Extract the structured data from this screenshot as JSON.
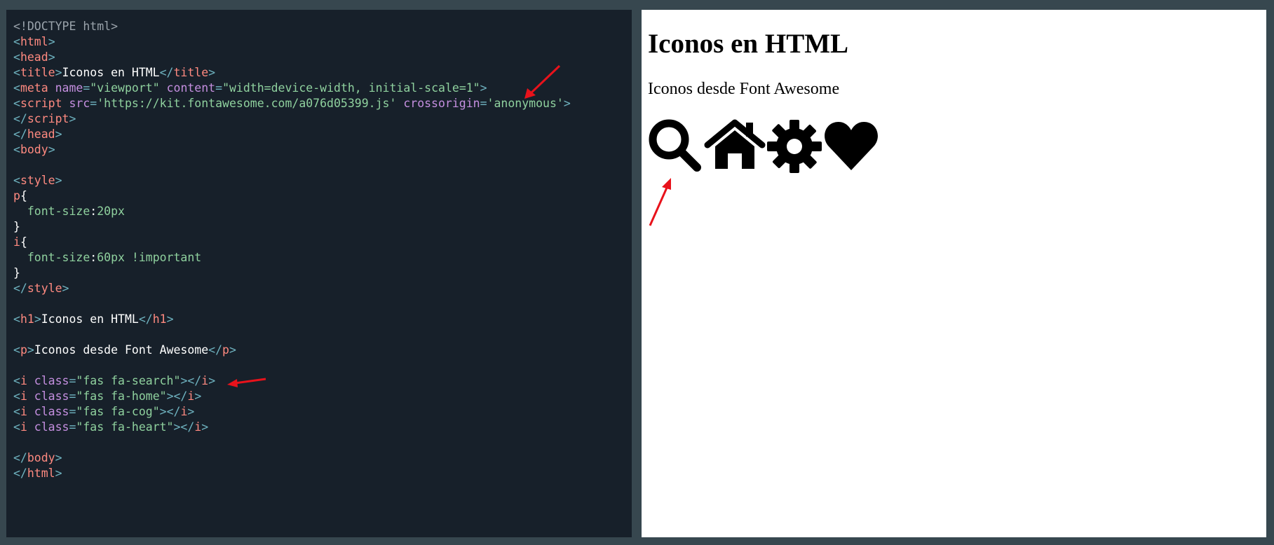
{
  "editor": {
    "lines": [
      [
        {
          "t": "<!DOCTYPE html>",
          "c": "doc"
        }
      ],
      [
        {
          "t": "<",
          "c": "punc"
        },
        {
          "t": "html",
          "c": "tag"
        },
        {
          "t": ">",
          "c": "punc"
        }
      ],
      [
        {
          "t": "<",
          "c": "punc"
        },
        {
          "t": "head",
          "c": "tag"
        },
        {
          "t": ">",
          "c": "punc"
        }
      ],
      [
        {
          "t": "<",
          "c": "punc"
        },
        {
          "t": "title",
          "c": "tag"
        },
        {
          "t": ">",
          "c": "punc"
        },
        {
          "t": "Iconos en HTML",
          "c": "text"
        },
        {
          "t": "</",
          "c": "punc"
        },
        {
          "t": "title",
          "c": "tag"
        },
        {
          "t": ">",
          "c": "punc"
        }
      ],
      [
        {
          "t": "<",
          "c": "punc"
        },
        {
          "t": "meta",
          "c": "tag"
        },
        {
          "t": " name",
          "c": "attr"
        },
        {
          "t": "=",
          "c": "punc"
        },
        {
          "t": "\"viewport\"",
          "c": "str"
        },
        {
          "t": " content",
          "c": "attr"
        },
        {
          "t": "=",
          "c": "punc"
        },
        {
          "t": "\"width=device-width, initial-scale=1\"",
          "c": "str"
        },
        {
          "t": ">",
          "c": "punc"
        }
      ],
      [
        {
          "t": "<",
          "c": "punc"
        },
        {
          "t": "script",
          "c": "tag"
        },
        {
          "t": " src",
          "c": "attr"
        },
        {
          "t": "=",
          "c": "punc"
        },
        {
          "t": "'https://kit.fontawesome.com/a076d05399.js'",
          "c": "str"
        },
        {
          "t": " crossorigin",
          "c": "attr"
        },
        {
          "t": "=",
          "c": "punc"
        },
        {
          "t": "'anonymous'",
          "c": "str"
        },
        {
          "t": ">",
          "c": "punc"
        }
      ],
      [
        {
          "t": "</",
          "c": "punc"
        },
        {
          "t": "script",
          "c": "tag"
        },
        {
          "t": ">",
          "c": "punc"
        }
      ],
      [
        {
          "t": "</",
          "c": "punc"
        },
        {
          "t": "head",
          "c": "tag"
        },
        {
          "t": ">",
          "c": "punc"
        }
      ],
      [
        {
          "t": "<",
          "c": "punc"
        },
        {
          "t": "body",
          "c": "tag"
        },
        {
          "t": ">",
          "c": "punc"
        }
      ],
      [],
      [
        {
          "t": "<",
          "c": "punc"
        },
        {
          "t": "style",
          "c": "tag"
        },
        {
          "t": ">",
          "c": "punc"
        }
      ],
      [
        {
          "t": "p",
          "c": "sel"
        },
        {
          "t": "{",
          "c": "text"
        }
      ],
      [
        {
          "t": "  font-size",
          "c": "prop"
        },
        {
          "t": ":",
          "c": "text"
        },
        {
          "t": "20px",
          "c": "num"
        }
      ],
      [
        {
          "t": "}",
          "c": "text"
        }
      ],
      [
        {
          "t": "i",
          "c": "sel"
        },
        {
          "t": "{",
          "c": "text"
        }
      ],
      [
        {
          "t": "  font-size",
          "c": "prop"
        },
        {
          "t": ":",
          "c": "text"
        },
        {
          "t": "60px !important",
          "c": "num"
        }
      ],
      [
        {
          "t": "}",
          "c": "text"
        }
      ],
      [
        {
          "t": "</",
          "c": "punc"
        },
        {
          "t": "style",
          "c": "tag"
        },
        {
          "t": ">",
          "c": "punc"
        }
      ],
      [],
      [
        {
          "t": "<",
          "c": "punc"
        },
        {
          "t": "h1",
          "c": "tag"
        },
        {
          "t": ">",
          "c": "punc"
        },
        {
          "t": "Iconos en HTML",
          "c": "text"
        },
        {
          "t": "</",
          "c": "punc"
        },
        {
          "t": "h1",
          "c": "tag"
        },
        {
          "t": ">",
          "c": "punc"
        }
      ],
      [],
      [
        {
          "t": "<",
          "c": "punc"
        },
        {
          "t": "p",
          "c": "tag"
        },
        {
          "t": ">",
          "c": "punc"
        },
        {
          "t": "Iconos desde Font Awesome",
          "c": "text"
        },
        {
          "t": "</",
          "c": "punc"
        },
        {
          "t": "p",
          "c": "tag"
        },
        {
          "t": ">",
          "c": "punc"
        }
      ],
      [],
      [
        {
          "t": "<",
          "c": "punc"
        },
        {
          "t": "i",
          "c": "tag"
        },
        {
          "t": " class",
          "c": "attr"
        },
        {
          "t": "=",
          "c": "punc"
        },
        {
          "t": "\"fas fa-search\"",
          "c": "str"
        },
        {
          "t": "></",
          "c": "punc"
        },
        {
          "t": "i",
          "c": "tag"
        },
        {
          "t": ">",
          "c": "punc"
        }
      ],
      [
        {
          "t": "<",
          "c": "punc"
        },
        {
          "t": "i",
          "c": "tag"
        },
        {
          "t": " class",
          "c": "attr"
        },
        {
          "t": "=",
          "c": "punc"
        },
        {
          "t": "\"fas fa-home\"",
          "c": "str"
        },
        {
          "t": "></",
          "c": "punc"
        },
        {
          "t": "i",
          "c": "tag"
        },
        {
          "t": ">",
          "c": "punc"
        }
      ],
      [
        {
          "t": "<",
          "c": "punc"
        },
        {
          "t": "i",
          "c": "tag"
        },
        {
          "t": " class",
          "c": "attr"
        },
        {
          "t": "=",
          "c": "punc"
        },
        {
          "t": "\"fas fa-cog\"",
          "c": "str"
        },
        {
          "t": "></",
          "c": "punc"
        },
        {
          "t": "i",
          "c": "tag"
        },
        {
          "t": ">",
          "c": "punc"
        }
      ],
      [
        {
          "t": "<",
          "c": "punc"
        },
        {
          "t": "i",
          "c": "tag"
        },
        {
          "t": " class",
          "c": "attr"
        },
        {
          "t": "=",
          "c": "punc"
        },
        {
          "t": "\"fas fa-heart\"",
          "c": "str"
        },
        {
          "t": "></",
          "c": "punc"
        },
        {
          "t": "i",
          "c": "tag"
        },
        {
          "t": ">",
          "c": "punc"
        }
      ],
      [],
      [
        {
          "t": "</",
          "c": "punc"
        },
        {
          "t": "body",
          "c": "tag"
        },
        {
          "t": ">",
          "c": "punc"
        }
      ],
      [
        {
          "t": "</",
          "c": "punc"
        },
        {
          "t": "html",
          "c": "tag"
        },
        {
          "t": ">",
          "c": "punc"
        }
      ]
    ]
  },
  "preview": {
    "heading": "Iconos en HTML",
    "paragraph": "Iconos desde Font Awesome",
    "icons": [
      "search-icon",
      "home-icon",
      "cog-icon",
      "heart-icon"
    ]
  },
  "colors": {
    "frame": "#37474f",
    "editor_bg": "#17202a",
    "tag": "#ff8a80",
    "attribute": "#c58fe0",
    "string": "#8fd19e",
    "punctuation": "#6fb3c0",
    "annotation_arrow": "#e8121b"
  }
}
